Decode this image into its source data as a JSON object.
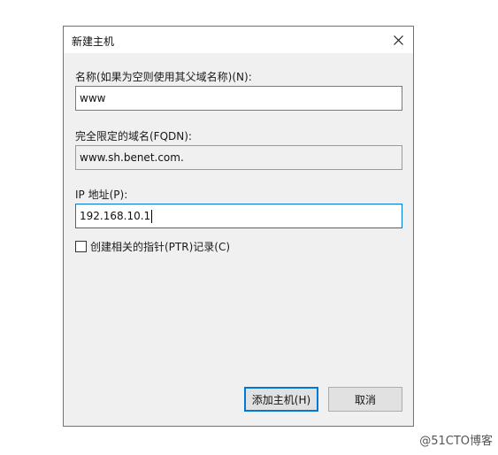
{
  "dialog": {
    "title": "新建主机",
    "name_label": "名称(如果为空则使用其父域名称)(N):",
    "name_value": "www",
    "fqdn_label": "完全限定的域名(FQDN):",
    "fqdn_value": "www.sh.benet.com.",
    "ip_label": "IP 地址(P):",
    "ip_value": "192.168.10.1",
    "ptr_checkbox_label": "创建相关的指针(PTR)记录(C)",
    "ptr_checked": false,
    "add_button": "添加主机(H)",
    "cancel_button": "取消"
  },
  "watermark": "@51CTO博客",
  "icons": {
    "close": "close-icon"
  },
  "colors": {
    "accent": "#0078d7",
    "window_border": "#3c7fc5"
  }
}
